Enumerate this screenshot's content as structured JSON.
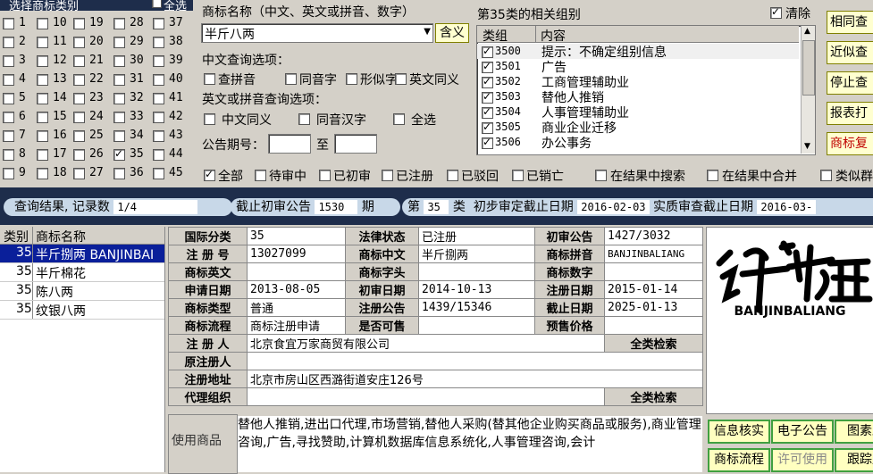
{
  "classes": {
    "header": "选择商标类别",
    "select_all": "全选",
    "columns": [
      [
        "1",
        "2",
        "3",
        "4",
        "5",
        "6",
        "7",
        "8",
        "9"
      ],
      [
        "10",
        "11",
        "12",
        "13",
        "14",
        "15",
        "16",
        "17",
        "18"
      ],
      [
        "19",
        "20",
        "21",
        "22",
        "23",
        "24",
        "25",
        "26",
        "27"
      ],
      [
        "28",
        "29",
        "30",
        "31",
        "32",
        "33",
        "34",
        "35",
        "36"
      ],
      [
        "37",
        "38",
        "39",
        "40",
        "41",
        "42",
        "43",
        "44",
        "45"
      ]
    ]
  },
  "search": {
    "name_label": "商标名称（中文、英文或拼音、数字）",
    "name_value": "半斤八两",
    "include_button": "含义",
    "cn_options_label": "中文查询选项：",
    "cn_options": [
      "查拼音",
      "同音字",
      "形似字",
      "英文同义"
    ],
    "en_options_label": "英文或拼音查询选项：",
    "en_options": [
      "中文同义",
      "同音汉字",
      "全选"
    ],
    "issue_label": "公告期号：",
    "issue_to": "至"
  },
  "groups": {
    "title": "第35类的相关组别",
    "clear_label": "清除",
    "col_group": "类组",
    "col_content": "内容",
    "rows": [
      {
        "code": "3500",
        "text": "提示：不确定组别信息"
      },
      {
        "code": "3501",
        "text": "广告"
      },
      {
        "code": "3502",
        "text": "工商管理辅助业"
      },
      {
        "code": "3503",
        "text": "替他人推销"
      },
      {
        "code": "3504",
        "text": "人事管理辅助业"
      },
      {
        "code": "3505",
        "text": "商业企业迁移"
      },
      {
        "code": "3506",
        "text": "办公事务"
      }
    ]
  },
  "side_buttons": [
    "相同查",
    "近似查",
    "停止查",
    "报表打",
    "商标复"
  ],
  "status_filters": [
    "全部",
    "待审中",
    "已初审",
    "已注册",
    "已驳回",
    "已销亡"
  ],
  "extra_filters": [
    "在结果中搜索",
    "在结果中合并",
    "类似群"
  ],
  "bar": {
    "result_label": "查询结果, 记录数",
    "result_value": "1/4",
    "cutoff_label": "截止初审公告",
    "cutoff_value": "1530",
    "cutoff_unit": "期",
    "class_prefix": "第",
    "class_value": "35",
    "class_suffix": "类",
    "prelim_label": "初步审定截止日期",
    "prelim_value": "2016-02-03",
    "exam_label": "实质审查截止日期",
    "exam_value": "2016-03-"
  },
  "result_list": {
    "col_class": "类别",
    "col_name": "商标名称",
    "rows": [
      {
        "cls": "35",
        "name": "半斤捌两 BANJINBAI"
      },
      {
        "cls": "35",
        "name": "半斤棉花"
      },
      {
        "cls": "35",
        "name": "陈八两"
      },
      {
        "cls": "35",
        "name": "纹银八两"
      }
    ]
  },
  "detail": {
    "intl_class_label": "国际分类",
    "intl_class": "35",
    "legal_status_label": "法律状态",
    "legal_status": "已注册",
    "prelim_pub_label": "初审公告",
    "prelim_pub": "1427/3032",
    "reg_no_label": "注 册 号",
    "reg_no": "13027099",
    "tm_cn_label": "商标中文",
    "tm_cn": "半斤捌两",
    "tm_pinyin_label": "商标拼音",
    "tm_pinyin": "BANJINBALIANG",
    "tm_en_label": "商标英文",
    "tm_en": "",
    "tm_initial_label": "商标字头",
    "tm_initial": "",
    "tm_digit_label": "商标数字",
    "tm_digit": "",
    "apply_date_label": "申请日期",
    "apply_date": "2013-08-05",
    "prelim_date_label": "初审日期",
    "prelim_date": "2014-10-13",
    "reg_date_label": "注册日期",
    "reg_date": "2015-01-14",
    "tm_type_label": "商标类型",
    "tm_type": "普通",
    "reg_pub_label": "注册公告",
    "reg_pub": "1439/15346",
    "expire_label": "截止日期",
    "expire": "2025-01-13",
    "flow_label": "商标流程",
    "flow": "商标注册申请",
    "for_sale_label": "是否可售",
    "for_sale": "",
    "presale_label": "预售价格",
    "presale": "",
    "registrant_label": "注 册 人",
    "registrant": "北京食宜万家商贸有限公司",
    "full_search": "全类检索",
    "orig_registrant_label": "原注册人",
    "orig_registrant": "",
    "address_label": "注册地址",
    "address": "北京市房山区西潞街道安庄126号",
    "agent_label": "代理组织",
    "agent": "",
    "goods_label": "使用商品",
    "goods": "替他人推销,进出口代理,市场营销,替他人采购(替其他企业购买商品或服务),商业管理咨询,广告,寻找赞助,计算机数据库信息系统化,人事管理咨询,会计"
  },
  "logo": {
    "pinyin": "BANJINBALIANG"
  },
  "bottom_buttons": [
    "信息核实",
    "电子公告",
    "图素跟",
    "商标流程",
    "许可使用",
    "跟踪监"
  ]
}
